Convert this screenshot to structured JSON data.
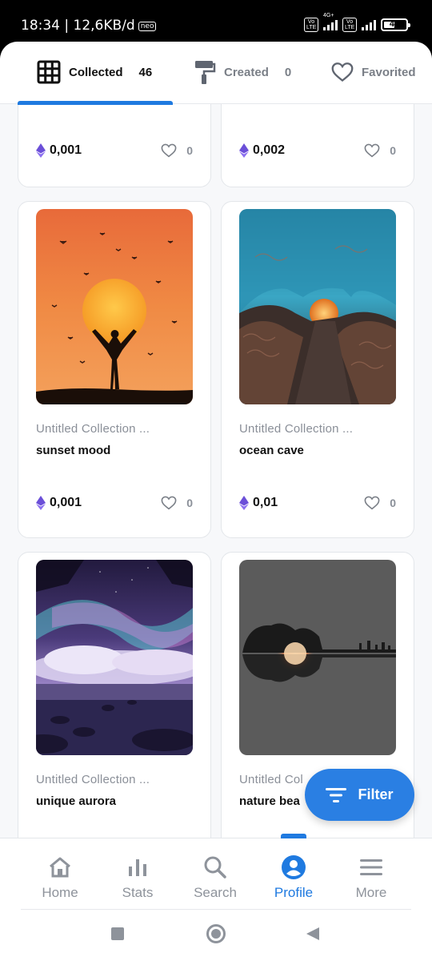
{
  "status": {
    "time": "18:34 | 12,6KB/d",
    "neo": "neo",
    "volte": "Vo LTE",
    "net": "4G+",
    "battery": "49",
    "battery_level": 0.49
  },
  "tabs": [
    {
      "label": "Collected",
      "count": "46",
      "icon": "grid-icon",
      "active": true
    },
    {
      "label": "Created",
      "count": "0",
      "icon": "paint-roller-icon",
      "active": false
    },
    {
      "label": "Favorited",
      "icon": "heart-icon",
      "active": false
    }
  ],
  "cards": [
    {
      "collection": "",
      "name": "",
      "price": "0,001",
      "likes": "0"
    },
    {
      "collection": "",
      "name": "",
      "price": "0,002",
      "likes": "0"
    },
    {
      "collection": "Untitled Collection ...",
      "name": "sunset mood",
      "price": "0,001",
      "likes": "0"
    },
    {
      "collection": "Untitled Collection ...",
      "name": "ocean cave",
      "price": "0,01",
      "likes": "0"
    },
    {
      "collection": "Untitled Collection ...",
      "name": "unique aurora",
      "price": "",
      "likes": ""
    },
    {
      "collection": "Untitled Col",
      "name": "nature bea",
      "price": "",
      "likes": ""
    }
  ],
  "fab": {
    "label": "Filter"
  },
  "nav": [
    {
      "label": "Home",
      "icon": "home-icon"
    },
    {
      "label": "Stats",
      "icon": "bar-chart-icon"
    },
    {
      "label": "Search",
      "icon": "search-icon"
    },
    {
      "label": "Profile",
      "icon": "profile-icon",
      "active": true
    },
    {
      "label": "More",
      "icon": "menu-icon"
    }
  ],
  "colors": {
    "accent": "#1f7ae0",
    "fab": "#2a7fe3",
    "eth": "#6b4fd8",
    "text": "#111111",
    "muted": "#8a8f98"
  }
}
